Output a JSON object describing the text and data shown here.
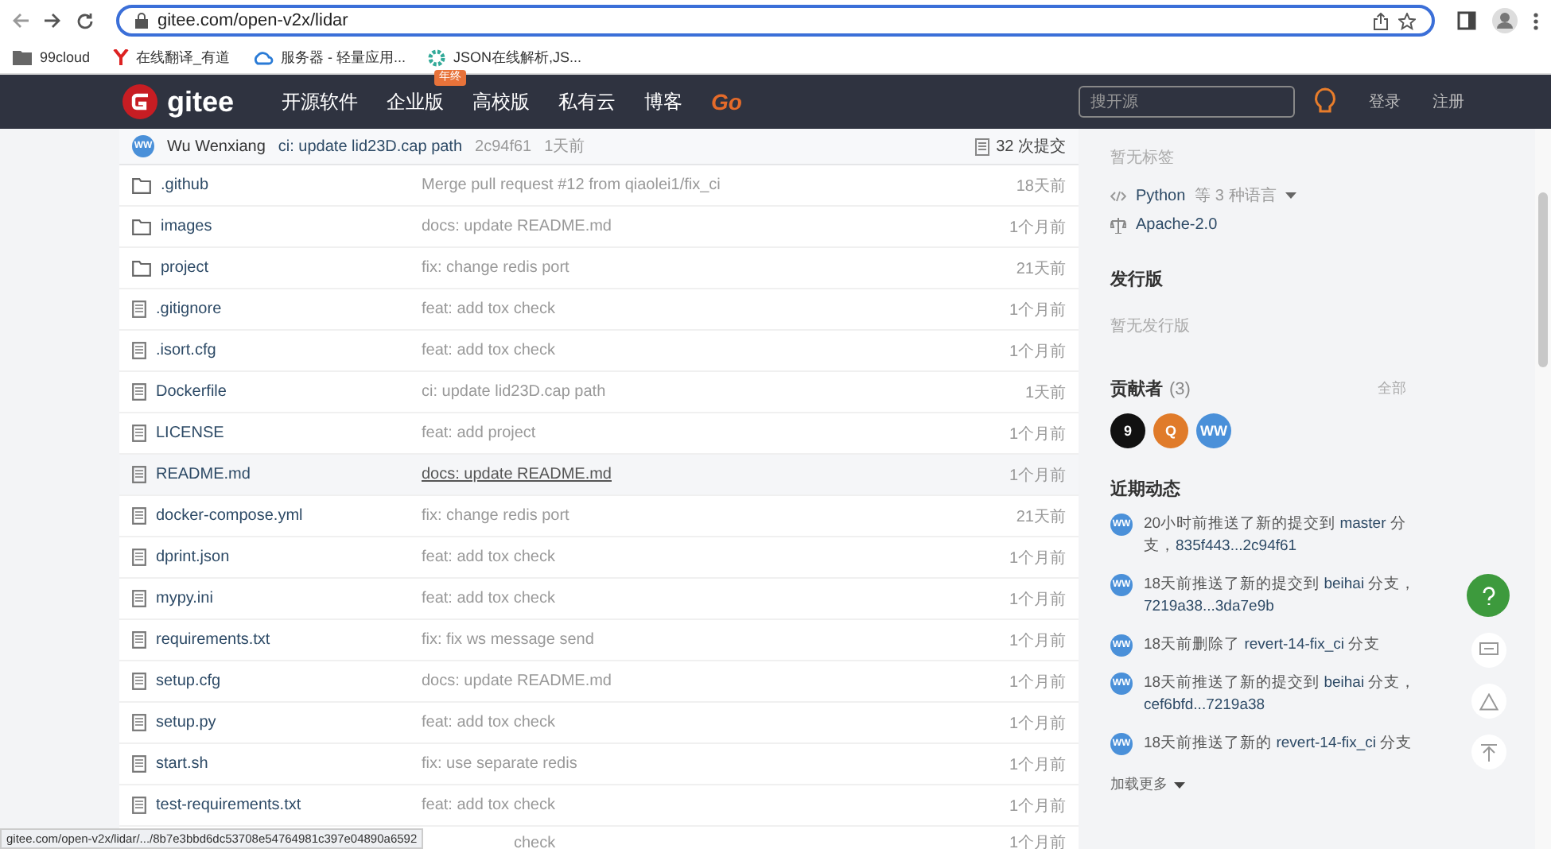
{
  "browser": {
    "url": "gitee.com/open-v2x/lidar",
    "bookmarks": [
      {
        "label": "99cloud",
        "kind": "folder"
      },
      {
        "label": "在线翻译_有道",
        "kind": "y"
      },
      {
        "label": "服务器 - 轻量应用...",
        "kind": "cloud"
      },
      {
        "label": "JSON在线解析,JS...",
        "kind": "gear"
      }
    ]
  },
  "header": {
    "logo": "gitee",
    "nav": [
      {
        "label": "开源软件"
      },
      {
        "label": "企业版",
        "badge": "年终"
      },
      {
        "label": "高校版"
      },
      {
        "label": "私有云"
      },
      {
        "label": "博客"
      },
      {
        "label": "Go",
        "kind": "accent"
      }
    ],
    "search": {
      "placeholder": "搜开源"
    },
    "login": "登录",
    "register": "注册"
  },
  "commit_bar": {
    "avatar": "WW",
    "author": "Wu Wenxiang",
    "message": "ci: update lid23D.cap path",
    "hash": "2c94f61",
    "time": "1天前",
    "commits": "32 次提交"
  },
  "files": [
    {
      "kind": "folder",
      "name": ".github",
      "message": "Merge pull request #12 from qiaolei1/fix_ci",
      "time": "18天前",
      "hovered": false
    },
    {
      "kind": "folder",
      "name": "images",
      "message": "docs: update README.md",
      "time": "1个月前",
      "hovered": false
    },
    {
      "kind": "folder",
      "name": "project",
      "message": "fix: change redis port",
      "time": "21天前",
      "hovered": false
    },
    {
      "kind": "file",
      "name": ".gitignore",
      "message": "feat: add tox check",
      "time": "1个月前",
      "hovered": false
    },
    {
      "kind": "file",
      "name": ".isort.cfg",
      "message": "feat: add tox check",
      "time": "1个月前",
      "hovered": false
    },
    {
      "kind": "file",
      "name": "Dockerfile",
      "message": "ci: update lid23D.cap path",
      "time": "1天前",
      "hovered": false
    },
    {
      "kind": "file",
      "name": "LICENSE",
      "message": "feat: add project",
      "time": "1个月前",
      "hovered": false
    },
    {
      "kind": "file",
      "name": "README.md",
      "message": "docs: update README.md",
      "time": "1个月前",
      "hovered": true
    },
    {
      "kind": "file",
      "name": "docker-compose.yml",
      "message": "fix: change redis port",
      "time": "21天前",
      "hovered": false
    },
    {
      "kind": "file",
      "name": "dprint.json",
      "message": "feat: add tox check",
      "time": "1个月前",
      "hovered": false
    },
    {
      "kind": "file",
      "name": "mypy.ini",
      "message": "feat: add tox check",
      "time": "1个月前",
      "hovered": false
    },
    {
      "kind": "file",
      "name": "requirements.txt",
      "message": "fix: fix ws message send",
      "time": "1个月前",
      "hovered": false
    },
    {
      "kind": "file",
      "name": "setup.cfg",
      "message": "docs: update README.md",
      "time": "1个月前",
      "hovered": false
    },
    {
      "kind": "file",
      "name": "setup.py",
      "message": "feat: add tox check",
      "time": "1个月前",
      "hovered": false
    },
    {
      "kind": "file",
      "name": "start.sh",
      "message": "fix: use separate redis",
      "time": "1个月前",
      "hovered": false
    },
    {
      "kind": "file",
      "name": "test-requirements.txt",
      "message": "feat: add tox check",
      "time": "1个月前",
      "hovered": false
    },
    {
      "kind": "hidden",
      "message": "check",
      "time": "1个月前"
    }
  ],
  "sidebar": {
    "tags": "暂无标签",
    "language": "Python",
    "language_suffix": "等 3 种语言",
    "license": "Apache-2.0",
    "releases_title": "发行版",
    "releases_empty": "暂无发行版",
    "contributors_title": "贡献者",
    "contributors_count": "(3)",
    "contributors_all": "全部",
    "contributors": [
      {
        "label": "9",
        "color": "#111111"
      },
      {
        "label": "Q",
        "color": "#e07b2a"
      },
      {
        "label": "WW",
        "color": "#4a90d9"
      }
    ],
    "activity_title": "近期动态",
    "activity": [
      {
        "avatar": "WW",
        "text": "20小时前推送了新的提交到",
        "link": "master",
        "after": "分支，",
        "ref": "835f443...2c94f61"
      },
      {
        "avatar": "WW",
        "text": "18天前推送了新的提交到",
        "link": "beihai",
        "after": "分支，",
        "ref": "7219a38...3da7e9b"
      },
      {
        "avatar": "WW",
        "text": "18天前删除了",
        "link": "revert-14-fix_ci",
        "after": "分支"
      },
      {
        "avatar": "WW",
        "text": "18天前推送了新的提交到",
        "link": "beihai",
        "after": "分支，",
        "ref": "cef6bfd...7219a38"
      },
      {
        "avatar": "WW",
        "text": "18天前推送了新的",
        "link": "revert-14-fix_ci",
        "after": "分支"
      }
    ],
    "load_more": "加载更多"
  },
  "status_url": "gitee.com/open-v2x/lidar/.../8b7e3bbd6dc53708e54764981c397e04890a6592"
}
